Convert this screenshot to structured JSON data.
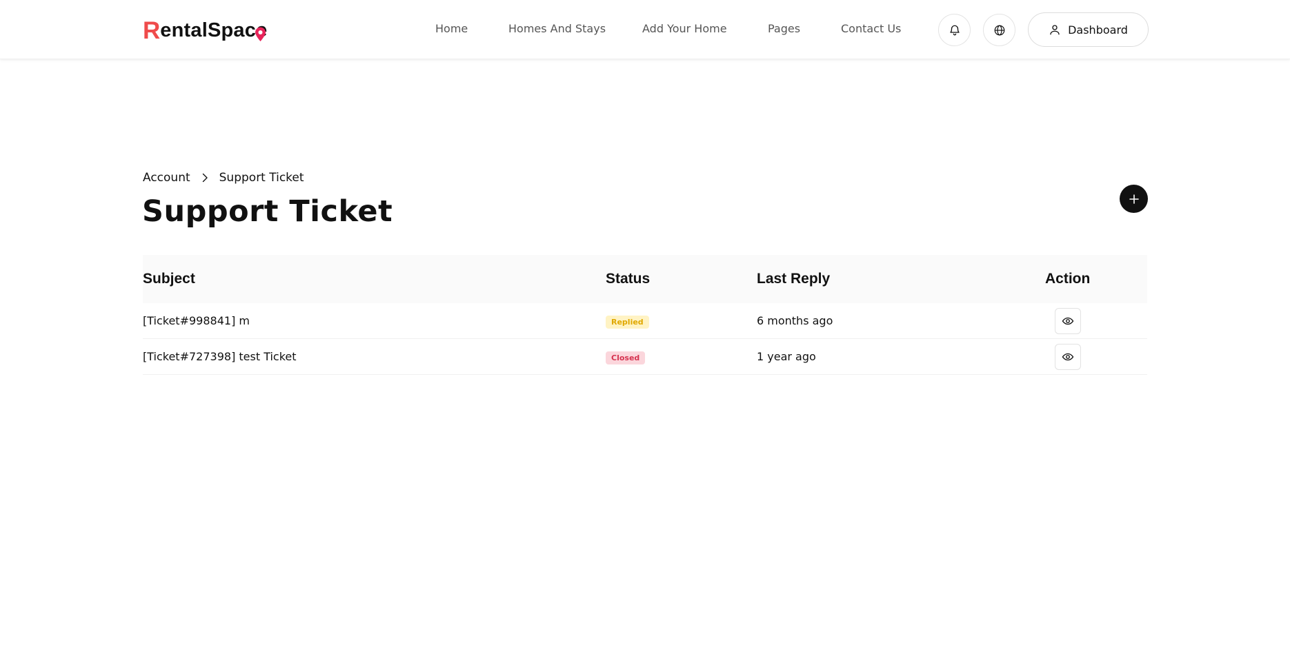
{
  "header": {
    "logo": {
      "initial": "R",
      "rest": "entalSpac",
      "tail": "e"
    },
    "nav": [
      {
        "label": "Home"
      },
      {
        "label": "Homes And Stays"
      },
      {
        "label": "Add Your Home"
      },
      {
        "label": "Pages"
      },
      {
        "label": "Contact Us"
      }
    ],
    "icons": {
      "notifications": "bell-icon",
      "language": "globe-icon",
      "user": "user-icon"
    },
    "dashboard_label": "Dashboard"
  },
  "breadcrumb": [
    {
      "label": "Account"
    },
    {
      "label": "Support Ticket"
    }
  ],
  "page_title": "Support Ticket",
  "table": {
    "columns": [
      "Subject",
      "Status",
      "Last Reply",
      "Action"
    ],
    "rows": [
      {
        "subject": "[Ticket#998841] m",
        "status": "Replied",
        "status_bg": "#fff3c4",
        "status_color": "#e0a800",
        "last_reply": "6 months ago"
      },
      {
        "subject": "[Ticket#727398] test Ticket",
        "status": "Closed",
        "status_bg": "#fbd6dc",
        "status_color": "#d63350",
        "last_reply": "1 year ago"
      }
    ]
  },
  "colors": {
    "brand": "#ef4b4b",
    "brand_pin": "#e8245a",
    "dark": "#111111"
  }
}
